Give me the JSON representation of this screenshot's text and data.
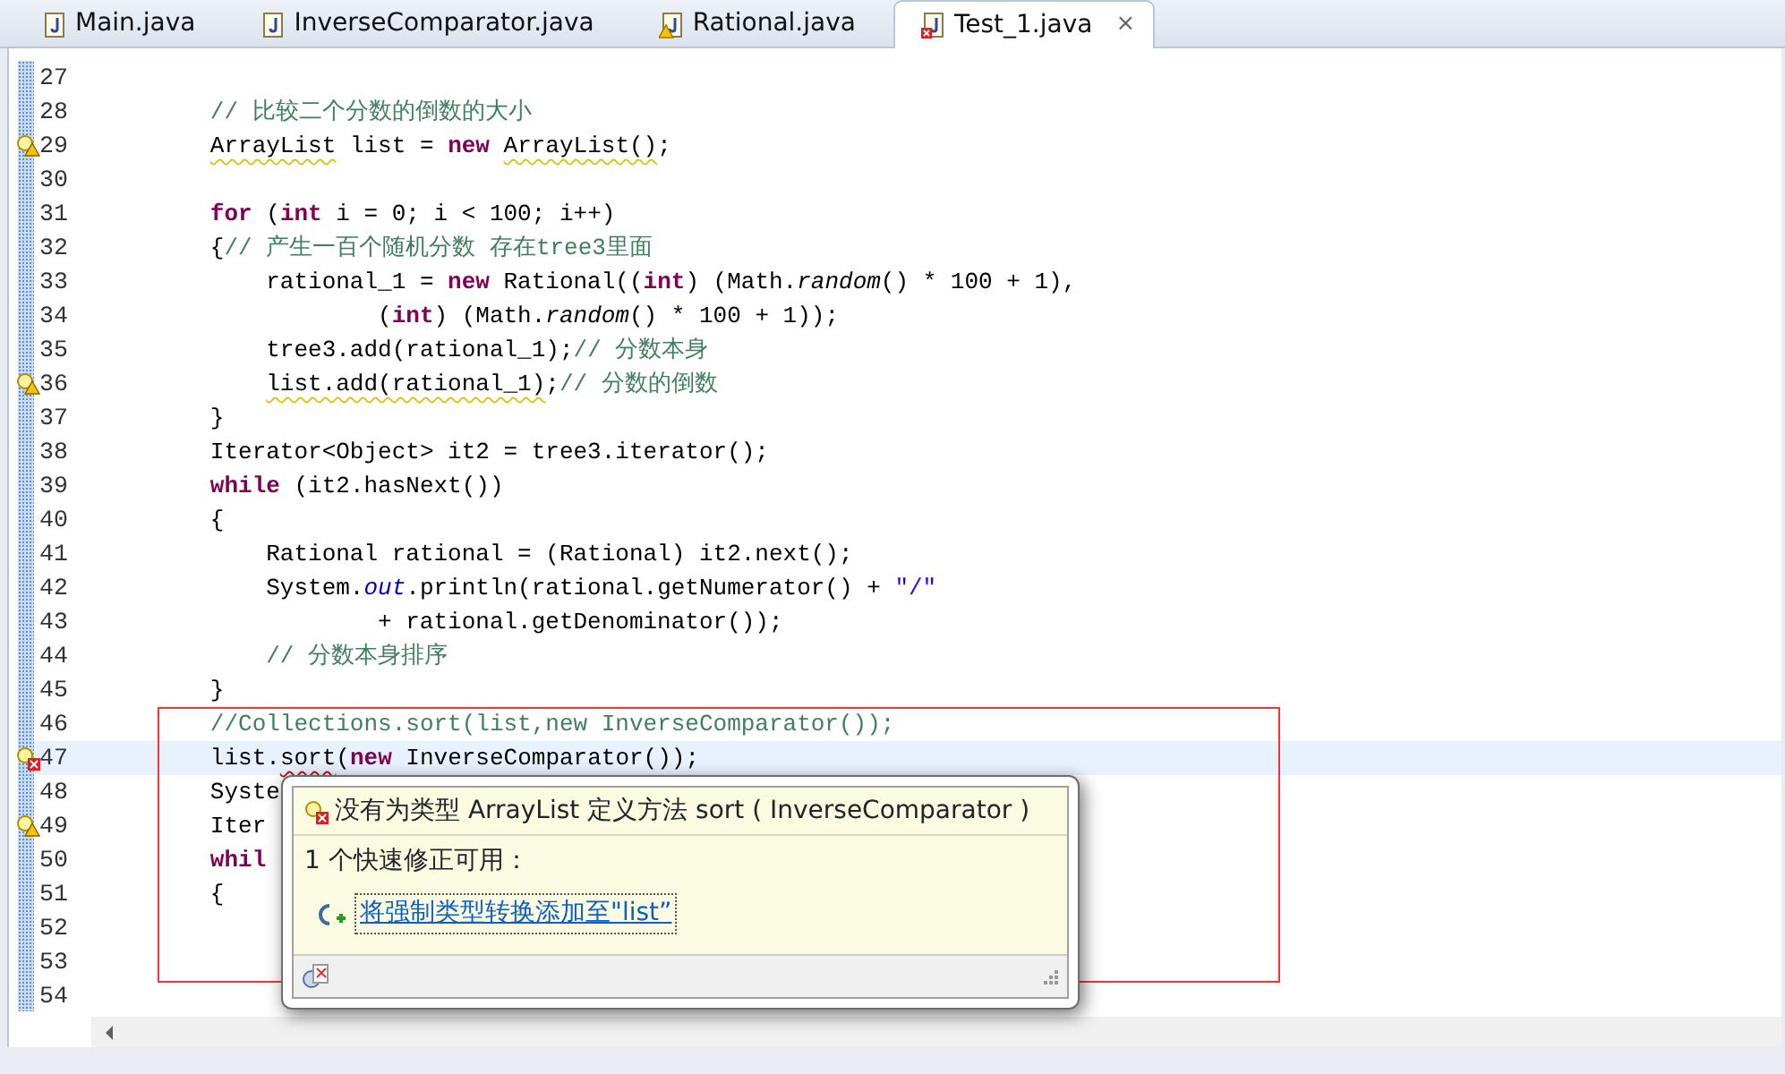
{
  "tabs": [
    {
      "label": "Main.java",
      "selected": false,
      "warning": false,
      "error": false
    },
    {
      "label": "InverseComparator.java",
      "selected": false,
      "warning": false,
      "error": false
    },
    {
      "label": "Rational.java",
      "selected": false,
      "warning": true,
      "error": false
    },
    {
      "label": "Test_1.java",
      "selected": true,
      "warning": false,
      "error": true,
      "close": "⨯"
    }
  ],
  "editor": {
    "lines": [
      {
        "number": "27",
        "warning": false,
        "error": false,
        "current": false
      },
      {
        "number": "28",
        "warning": false,
        "error": false,
        "current": false,
        "code": [
          {
            "comment": "        // 比较二个分数的倒数的大小"
          }
        ]
      },
      {
        "number": "29",
        "warning": true,
        "error": false,
        "current": false,
        "code": [
          {
            "warn": "        ArrayList"
          },
          {
            "text": " list = "
          },
          {
            "keyword": "new "
          },
          {
            "warn": "ArrayList()"
          },
          {
            "text": ";"
          }
        ]
      },
      {
        "number": "30",
        "warning": false,
        "error": false,
        "current": false
      },
      {
        "number": "31",
        "warning": false,
        "error": false,
        "current": false,
        "code": [
          {
            "keyword": "        for"
          },
          {
            "text": " ("
          },
          {
            "keyword": "int"
          },
          {
            "text": " i = 0; i < 100; i++)"
          }
        ]
      },
      {
        "number": "32",
        "warning": false,
        "error": false,
        "current": false,
        "code": [
          {
            "text": "        {"
          },
          {
            "comment": "// 产生一百个随机分数 存在tree3里面"
          }
        ]
      },
      {
        "number": "33",
        "warning": false,
        "error": false,
        "current": false,
        "code": [
          {
            "text": "            rational_1 = "
          },
          {
            "keyword": "new"
          },
          {
            "text": " Rational(("
          },
          {
            "keyword": "int"
          },
          {
            "text": ") (Math."
          },
          {
            "italic": "random"
          },
          {
            "text": "() * 100 + 1),"
          }
        ]
      },
      {
        "number": "34",
        "warning": false,
        "error": false,
        "current": false,
        "code": [
          {
            "text": "                    ("
          },
          {
            "keyword": "int"
          },
          {
            "text": ") (Math."
          },
          {
            "italic": "random"
          },
          {
            "text": "() * 100 + 1));"
          }
        ]
      },
      {
        "number": "35",
        "warning": false,
        "error": false,
        "current": false,
        "code": [
          {
            "text": "            tree3.add(rational_1);"
          },
          {
            "comment": "// 分数本身"
          }
        ]
      },
      {
        "number": "36",
        "warning": true,
        "error": false,
        "current": false,
        "code": [
          {
            "warn": "            list.add(rational_1)"
          },
          {
            "text": ";"
          },
          {
            "comment": "// 分数的倒数"
          }
        ]
      },
      {
        "number": "37",
        "warning": false,
        "error": false,
        "current": false,
        "code": [
          {
            "text": "        }"
          }
        ]
      },
      {
        "number": "38",
        "warning": false,
        "error": false,
        "current": false,
        "code": [
          {
            "text": "        Iterator<Object> it2 = tree3.iterator();"
          }
        ]
      },
      {
        "number": "39",
        "warning": false,
        "error": false,
        "current": false,
        "code": [
          {
            "keyword": "        while"
          },
          {
            "text": " (it2.hasNext())"
          }
        ]
      },
      {
        "number": "40",
        "warning": false,
        "error": false,
        "current": false,
        "code": [
          {
            "text": "        {"
          }
        ]
      },
      {
        "number": "41",
        "warning": false,
        "error": false,
        "current": false,
        "code": [
          {
            "text": "            Rational rational = (Rational) it2.next();"
          }
        ]
      },
      {
        "number": "42",
        "warning": false,
        "error": false,
        "current": false,
        "code": [
          {
            "text": "            System."
          },
          {
            "field": "out"
          },
          {
            "text": ".println(rational.getNumerator() + "
          },
          {
            "string": "\"/\""
          }
        ]
      },
      {
        "number": "43",
        "warning": false,
        "error": false,
        "current": false,
        "code": [
          {
            "text": "                    + rational.getDenominator());"
          }
        ]
      },
      {
        "number": "44",
        "warning": false,
        "error": false,
        "current": false,
        "code": [
          {
            "comment": "            // 分数本身排序"
          }
        ]
      },
      {
        "number": "45",
        "warning": false,
        "error": false,
        "current": false,
        "code": [
          {
            "text": "        }"
          }
        ]
      },
      {
        "number": "46",
        "warning": false,
        "error": false,
        "current": false,
        "code": [
          {
            "comment": "        //Collections.sort(list,new InverseComparator());"
          }
        ]
      },
      {
        "number": "47",
        "warning": false,
        "error": true,
        "current": true,
        "code": [
          {
            "text": "        list."
          },
          {
            "err": "sort"
          },
          {
            "text": "("
          },
          {
            "keyword": "new"
          },
          {
            "text": " InverseComparator());"
          }
        ]
      },
      {
        "number": "48",
        "warning": false,
        "error": false,
        "current": false,
        "code": [
          {
            "text": "        Syste"
          }
        ]
      },
      {
        "number": "49",
        "warning": true,
        "error": false,
        "current": false,
        "code": [
          {
            "text": "        Iter"
          }
        ]
      },
      {
        "number": "50",
        "warning": false,
        "error": false,
        "current": false,
        "code": [
          {
            "keyword": "        whil"
          }
        ]
      },
      {
        "number": "51",
        "warning": false,
        "error": false,
        "current": false,
        "code": [
          {
            "text": "        {"
          }
        ]
      },
      {
        "number": "52",
        "warning": false,
        "error": false,
        "current": false
      },
      {
        "number": "53",
        "warning": false,
        "error": false,
        "current": false
      },
      {
        "number": "54",
        "warning": false,
        "error": false,
        "current": false
      }
    ],
    "annotation_frame": true
  },
  "quick_fix": {
    "title": "没有为类型 ArrayList 定义方法 sort ( InverseComparator )",
    "summary": "1 个快速修正可用：",
    "fixes": [
      "将强制类型转换添加至\"list”"
    ]
  }
}
